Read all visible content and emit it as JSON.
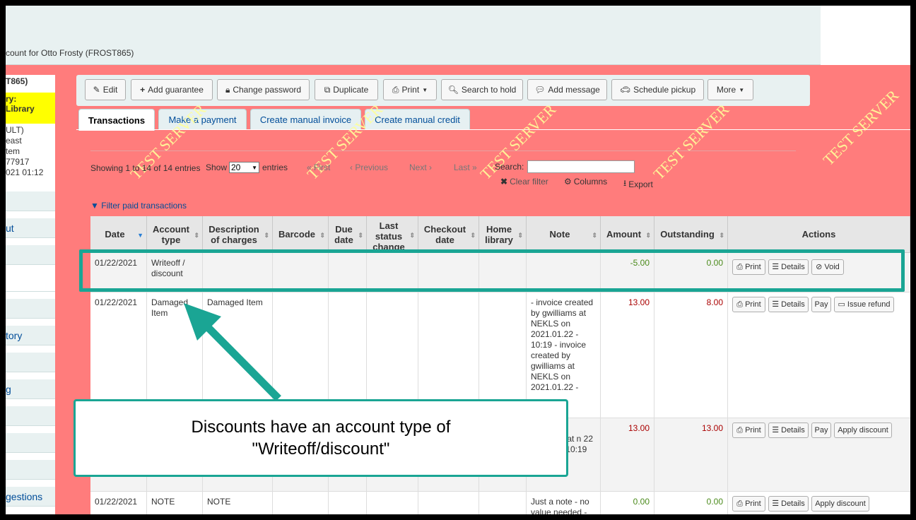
{
  "header": {
    "breadcrumb": "count for Otto Frosty (FROST865)"
  },
  "sidebar": {
    "patron_lines": [
      "T865)",
      "ry:",
      "Library",
      "ULT)",
      "east",
      "tem",
      "77917",
      "021 01:12"
    ],
    "items": [
      "",
      "ut",
      "",
      "",
      "",
      "tory",
      "",
      "g",
      "",
      "",
      "",
      "gestions"
    ]
  },
  "toolbar": {
    "edit": "Edit",
    "add_guarantee": "Add guarantee",
    "change_password": "Change password",
    "duplicate": "Duplicate",
    "print": "Print",
    "search_to_hold": "Search to hold",
    "add_message": "Add message",
    "schedule_pickup": "Schedule pickup",
    "more": "More"
  },
  "tabs": [
    "Transactions",
    "Make a payment",
    "Create manual invoice",
    "Create manual credit"
  ],
  "watermark": "TEST SERVER",
  "table_controls": {
    "showing": "Showing 1 to 14 of 14 entries",
    "show": "Show",
    "show_value": "20",
    "entries": "entries",
    "first": "First",
    "previous": "Previous",
    "next": "Next",
    "last": "Last",
    "search_label": "Search:",
    "clear_filter": "Clear filter",
    "columns": "Columns",
    "export": "Export",
    "filter_paid": "Filter paid transactions"
  },
  "columns": [
    "Date",
    "Account type",
    "Description of charges",
    "Barcode",
    "Due date",
    "Last status change",
    "Checkout date",
    "Home library",
    "Note",
    "Amount",
    "Outstanding",
    "Actions"
  ],
  "rows": [
    {
      "date": "01/22/2021",
      "account_type": "Writeoff / discount",
      "description": "",
      "note": "",
      "amount": "-5.00",
      "outstanding": "0.00",
      "actions": [
        "Print",
        "Details",
        "Void"
      ]
    },
    {
      "date": "01/22/2021",
      "account_type": "Damaged Item",
      "description": "Damaged Item",
      "note": "- invoice created by gwilliams at NEKLS on 2021.01.22 - 10:19 - invoice created by gwilliams at NEKLS on 2021.01.22 -",
      "amount": "13.00",
      "outstanding": "8.00",
      "actions": [
        "Print",
        "Details",
        "Pay",
        "Issue refund"
      ]
    },
    {
      "date": "",
      "account_type": "",
      "description": "",
      "note": "y at n 22 - 10:19",
      "amount": "13.00",
      "outstanding": "13.00",
      "actions": [
        "Print",
        "Details",
        "Pay",
        "Apply discount"
      ]
    },
    {
      "date": "01/22/2021",
      "account_type": "NOTE",
      "description": "NOTE",
      "note": "Just a note - no value needed -",
      "amount": "0.00",
      "outstanding": "0.00",
      "actions": [
        "Print",
        "Details",
        "Apply discount"
      ]
    }
  ],
  "callout": {
    "line1": "Discounts have an account type of",
    "line2": "\"Writeoff/discount\""
  },
  "colors": {
    "page_bg": "#ff7c7c",
    "annotation": "#1aa594",
    "watermark": "#ffff99"
  }
}
